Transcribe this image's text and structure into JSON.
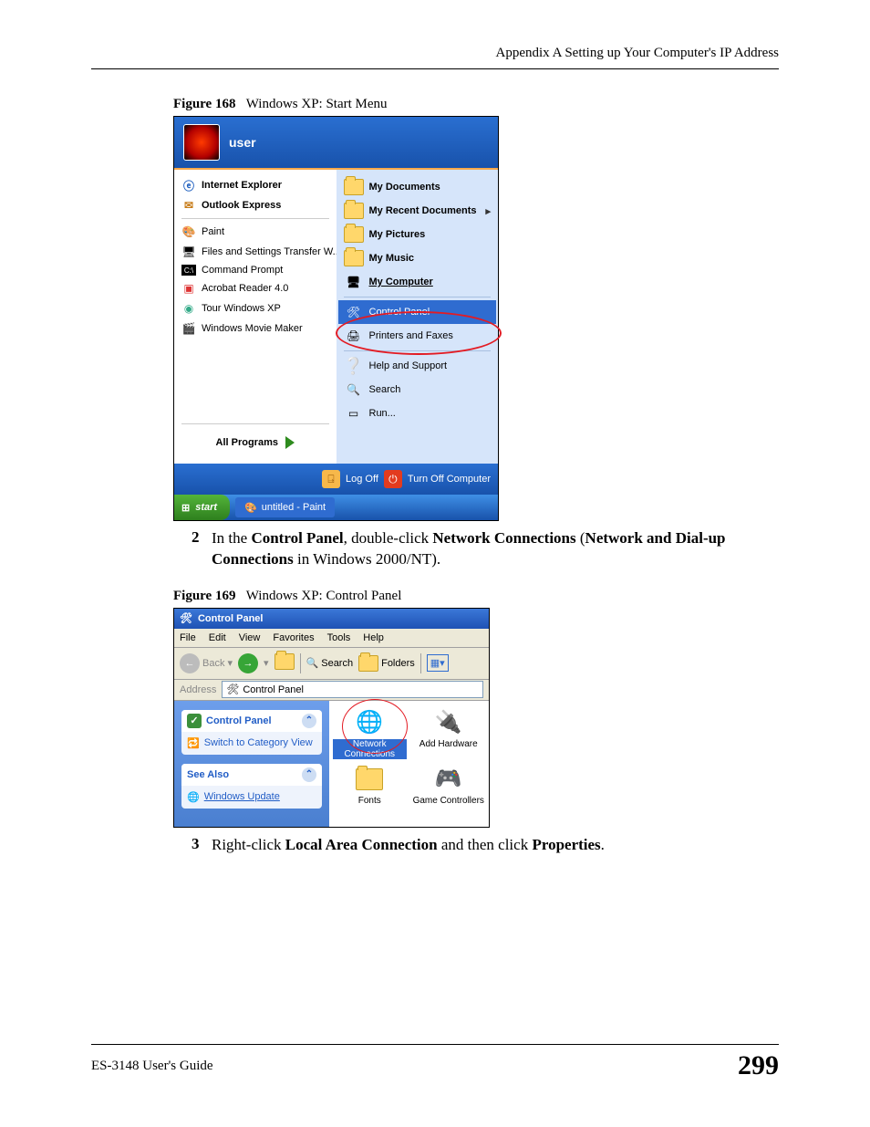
{
  "header": "Appendix A Setting up Your Computer's IP Address",
  "figure168": {
    "label": "Figure 168",
    "title": "Windows XP: Start Menu"
  },
  "startmenu": {
    "user": "user",
    "left_pinned": [
      {
        "label": "Internet Explorer",
        "bold": true
      },
      {
        "label": "Outlook Express",
        "bold": true
      }
    ],
    "left_recent": [
      {
        "label": "Paint"
      },
      {
        "label": "Files and Settings Transfer W..."
      },
      {
        "label": "Command Prompt"
      },
      {
        "label": "Acrobat Reader 4.0"
      },
      {
        "label": "Tour Windows XP"
      },
      {
        "label": "Windows Movie Maker"
      }
    ],
    "all_programs": "All Programs",
    "right": [
      {
        "label": "My Documents",
        "bold": true
      },
      {
        "label": "My Recent Documents",
        "bold": true,
        "submenu": true
      },
      {
        "label": "My Pictures",
        "bold": true
      },
      {
        "label": "My Music",
        "bold": true
      },
      {
        "label": "My Computer",
        "bold": true,
        "underline": true
      },
      {
        "sep": true
      },
      {
        "label": "Control Panel",
        "highlight": true
      },
      {
        "label": "Printers and Faxes"
      },
      {
        "sep": true
      },
      {
        "label": "Help and Support"
      },
      {
        "label": "Search"
      },
      {
        "label": "Run..."
      }
    ],
    "logoff": "Log Off",
    "turnoff": "Turn Off Computer",
    "start": "start",
    "taskapp": "untitled - Paint"
  },
  "step2": {
    "num": "2",
    "t1": "In the ",
    "b1": "Control Panel",
    "t2": ", double-click ",
    "b2": "Network Connections",
    "t3": " (",
    "b3": "Network and Dial-up Connections",
    "t4": " in Windows 2000/NT)."
  },
  "figure169": {
    "label": "Figure 169",
    "title": "Windows XP: Control Panel"
  },
  "cp": {
    "title": "Control Panel",
    "menus": [
      "File",
      "Edit",
      "View",
      "Favorites",
      "Tools",
      "Help"
    ],
    "back": "Back",
    "search": "Search",
    "folders": "Folders",
    "address_label": "Address",
    "address_value": "Control Panel",
    "side_panel_title": "Control Panel",
    "side_switch": "Switch to Category View",
    "see_also": "See Also",
    "windows_update": "Windows Update",
    "icons": [
      {
        "label": "Network Connections",
        "highlight": true
      },
      {
        "label": "Add Hardware"
      },
      {
        "label": "Fonts"
      },
      {
        "label": "Game Controllers"
      }
    ]
  },
  "step3": {
    "num": "3",
    "t1": "Right-click ",
    "b1": "Local Area Connection",
    "t2": " and then click ",
    "b2": "Properties",
    "t3": "."
  },
  "footer": {
    "guide": "ES-3148 User's Guide",
    "page": "299"
  }
}
